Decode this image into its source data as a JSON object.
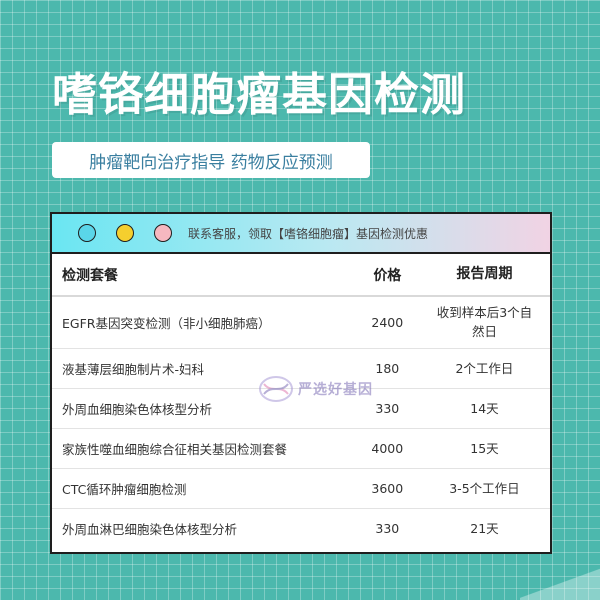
{
  "page": {
    "title": "嗜铬细胞瘤基因检测",
    "subtitle": "肿瘤靶向治疗指导 药物反应预测"
  },
  "card": {
    "notice": "联系客服，领取【嗜铬细胞瘤】基因检测优惠",
    "dots": [
      "cyan-dot",
      "yellow-dot",
      "pink-dot"
    ],
    "headers": {
      "package": "检测套餐",
      "price": "价格",
      "period": "报告周期"
    },
    "rows": [
      {
        "name": "EGFR基因突变检测（非小细胞肺癌）",
        "price": "2400",
        "period": "收到样本后3个自然日"
      },
      {
        "name": "液基薄层细胞制片术-妇科",
        "price": "180",
        "period": "2个工作日"
      },
      {
        "name": "外周血细胞染色体核型分析",
        "price": "330",
        "period": "14天"
      },
      {
        "name": "家族性噬血细胞综合征相关基因检测套餐",
        "price": "4000",
        "period": "15天"
      },
      {
        "name": "CTC循环肿瘤细胞检测",
        "price": "3600",
        "period": "3-5个工作日"
      },
      {
        "name": "外周血淋巴细胞染色体核型分析",
        "price": "330",
        "period": "21天"
      }
    ]
  },
  "watermark": {
    "text": "严选好基因"
  },
  "colors": {
    "background": "#4cb8ad",
    "title": "#ffffff",
    "subtitle_text": "#3a7fa0",
    "header_gradient_start": "#6ae6f2",
    "header_gradient_end": "#f1d3e4"
  }
}
